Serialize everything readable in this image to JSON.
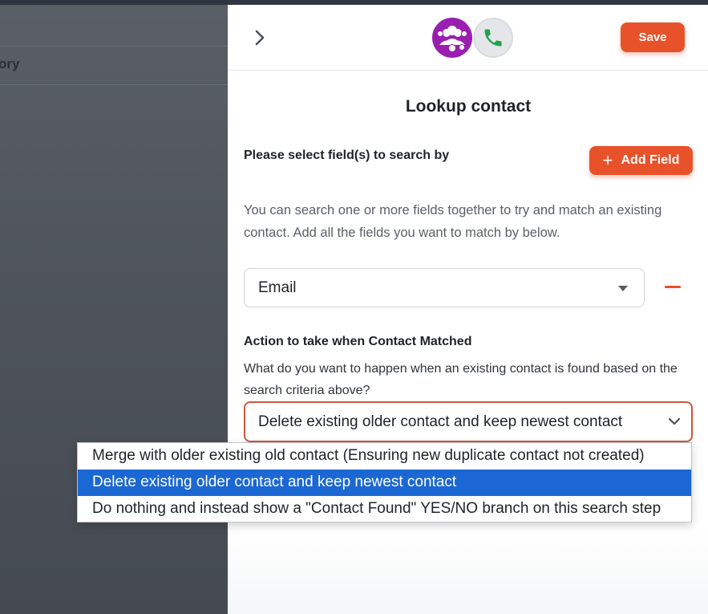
{
  "backdrop": {
    "partial_text": "ory"
  },
  "header": {
    "save_label": "Save"
  },
  "title": "Lookup contact",
  "search": {
    "label": "Please select field(s) to search by",
    "add_field_label": "Add Field",
    "help": "You can search one or more fields together to try and match an existing contact. Add all the fields you want to match by below.",
    "field_value": "Email"
  },
  "action": {
    "label": "Action to take when Contact Matched",
    "help": "What do you want to happen when an existing contact is found based on the search criteria above?",
    "selected": "Delete existing older contact and keep newest contact",
    "options": [
      "Merge with older existing old contact (Ensuring new duplicate contact not created)",
      "Delete existing older contact and keep newest contact",
      "Do nothing and instead show a \"Contact Found\" YES/NO branch on this search step"
    ],
    "selected_index": 1
  },
  "colors": {
    "accent": "#e8522a",
    "avatar_group": "#9a1fb0",
    "phone_green": "#1fa34a",
    "selection_blue": "#1b67d3"
  },
  "icons": {
    "back": "chevron-right-icon",
    "group": "user-group-icon",
    "phone": "phone-icon",
    "add": "plus-icon",
    "remove": "minus-icon",
    "expand": "chevron-down-icon"
  }
}
